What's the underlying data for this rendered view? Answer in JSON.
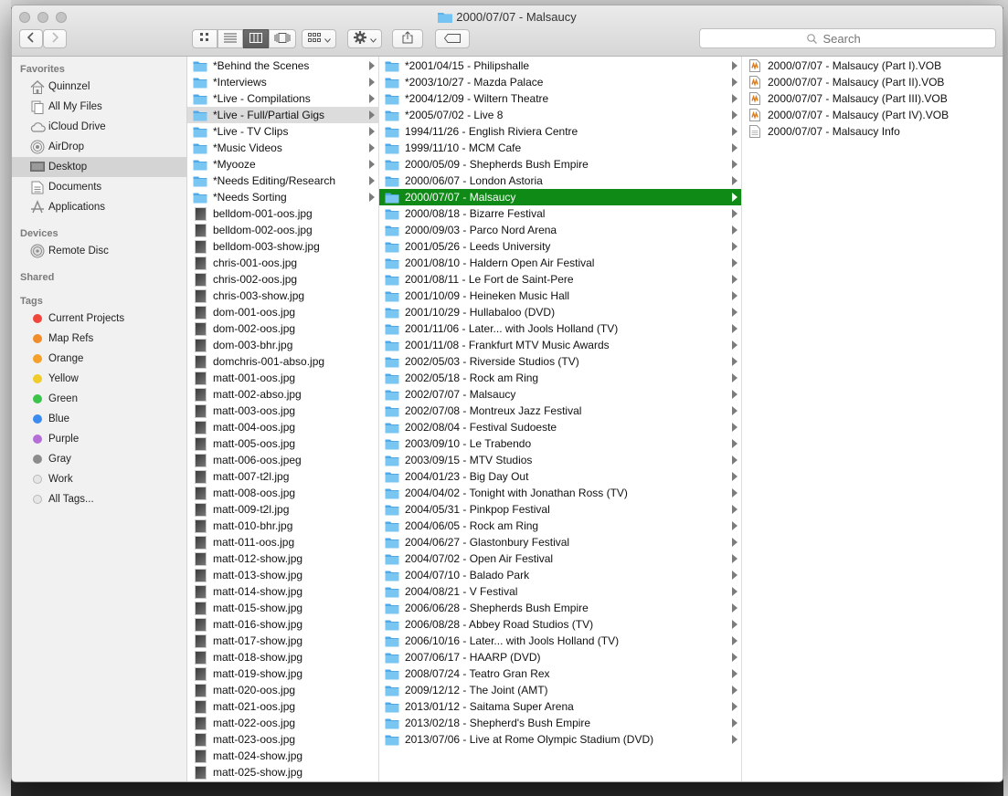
{
  "window": {
    "title": "2000/07/07 - Malsaucy"
  },
  "search": {
    "placeholder": "Search"
  },
  "sidebar": {
    "favorites_label": "Favorites",
    "favorites": [
      {
        "label": "Quinnzel",
        "icon": "home-icon"
      },
      {
        "label": "All My Files",
        "icon": "all-files-icon"
      },
      {
        "label": "iCloud Drive",
        "icon": "cloud-icon"
      },
      {
        "label": "AirDrop",
        "icon": "airdrop-icon"
      },
      {
        "label": "Desktop",
        "icon": "desktop-icon",
        "selected": true
      },
      {
        "label": "Documents",
        "icon": "documents-icon"
      },
      {
        "label": "Applications",
        "icon": "applications-icon"
      }
    ],
    "devices_label": "Devices",
    "devices": [
      {
        "label": "Remote Disc",
        "icon": "disc-icon"
      }
    ],
    "shared_label": "Shared",
    "tags_label": "Tags",
    "tags": [
      {
        "label": "Current Projects",
        "color": "#f0463c"
      },
      {
        "label": "Map Refs",
        "color": "#f08c2a"
      },
      {
        "label": "Orange",
        "color": "#f5a02a"
      },
      {
        "label": "Yellow",
        "color": "#f0cc2a"
      },
      {
        "label": "Green",
        "color": "#3cc34a"
      },
      {
        "label": "Blue",
        "color": "#3b8cf0"
      },
      {
        "label": "Purple",
        "color": "#b56ed8"
      },
      {
        "label": "Gray",
        "color": "#8c8c8c"
      },
      {
        "label": "Work",
        "color": "#e6e6e6"
      },
      {
        "label": "All Tags...",
        "color": "#e6e6e6"
      }
    ]
  },
  "column1": [
    {
      "label": "*Behind the Scenes",
      "kind": "folder"
    },
    {
      "label": "*Interviews",
      "kind": "folder"
    },
    {
      "label": "*Live - Compilations",
      "kind": "folder"
    },
    {
      "label": "*Live - Full/Partial Gigs",
      "kind": "folder",
      "selected": true
    },
    {
      "label": "*Live - TV Clips",
      "kind": "folder"
    },
    {
      "label": "*Music Videos",
      "kind": "folder"
    },
    {
      "label": "*Myooze",
      "kind": "folder"
    },
    {
      "label": "*Needs Editing/Research",
      "kind": "folder"
    },
    {
      "label": "*Needs Sorting",
      "kind": "folder"
    },
    {
      "label": "belldom-001-oos.jpg",
      "kind": "image"
    },
    {
      "label": "belldom-002-oos.jpg",
      "kind": "image"
    },
    {
      "label": "belldom-003-show.jpg",
      "kind": "image"
    },
    {
      "label": "chris-001-oos.jpg",
      "kind": "image"
    },
    {
      "label": "chris-002-oos.jpg",
      "kind": "image"
    },
    {
      "label": "chris-003-show.jpg",
      "kind": "image"
    },
    {
      "label": "dom-001-oos.jpg",
      "kind": "image"
    },
    {
      "label": "dom-002-oos.jpg",
      "kind": "image"
    },
    {
      "label": "dom-003-bhr.jpg",
      "kind": "image"
    },
    {
      "label": "domchris-001-abso.jpg",
      "kind": "image"
    },
    {
      "label": "matt-001-oos.jpg",
      "kind": "image"
    },
    {
      "label": "matt-002-abso.jpg",
      "kind": "image"
    },
    {
      "label": "matt-003-oos.jpg",
      "kind": "image"
    },
    {
      "label": "matt-004-oos.jpg",
      "kind": "image"
    },
    {
      "label": "matt-005-oos.jpg",
      "kind": "image"
    },
    {
      "label": "matt-006-oos.jpeg",
      "kind": "image"
    },
    {
      "label": "matt-007-t2l.jpg",
      "kind": "image"
    },
    {
      "label": "matt-008-oos.jpg",
      "kind": "image"
    },
    {
      "label": "matt-009-t2l.jpg",
      "kind": "image"
    },
    {
      "label": "matt-010-bhr.jpg",
      "kind": "image"
    },
    {
      "label": "matt-011-oos.jpg",
      "kind": "image"
    },
    {
      "label": "matt-012-show.jpg",
      "kind": "image"
    },
    {
      "label": "matt-013-show.jpg",
      "kind": "image"
    },
    {
      "label": "matt-014-show.jpg",
      "kind": "image"
    },
    {
      "label": "matt-015-show.jpg",
      "kind": "image"
    },
    {
      "label": "matt-016-show.jpg",
      "kind": "image"
    },
    {
      "label": "matt-017-show.jpg",
      "kind": "image"
    },
    {
      "label": "matt-018-show.jpg",
      "kind": "image"
    },
    {
      "label": "matt-019-show.jpg",
      "kind": "image"
    },
    {
      "label": "matt-020-oos.jpg",
      "kind": "image"
    },
    {
      "label": "matt-021-oos.jpg",
      "kind": "image"
    },
    {
      "label": "matt-022-oos.jpg",
      "kind": "image"
    },
    {
      "label": "matt-023-oos.jpg",
      "kind": "image"
    },
    {
      "label": "matt-024-show.jpg",
      "kind": "image"
    },
    {
      "label": "matt-025-show.jpg",
      "kind": "image"
    }
  ],
  "column2": [
    {
      "label": "*2001/04/15 - Philipshalle"
    },
    {
      "label": "*2003/10/27 - Mazda Palace"
    },
    {
      "label": "*2004/12/09 - Wiltern Theatre"
    },
    {
      "label": "*2005/07/02 - Live 8"
    },
    {
      "label": "1994/11/26 - English Riviera Centre"
    },
    {
      "label": "1999/11/10 - MCM Cafe"
    },
    {
      "label": "2000/05/09 - Shepherds Bush Empire"
    },
    {
      "label": "2000/06/07 - London Astoria"
    },
    {
      "label": "2000/07/07 - Malsaucy",
      "selected": true
    },
    {
      "label": "2000/08/18 - Bizarre Festival"
    },
    {
      "label": "2000/09/03 - Parco Nord Arena"
    },
    {
      "label": "2001/05/26 - Leeds University"
    },
    {
      "label": "2001/08/10 - Haldern Open Air Festival"
    },
    {
      "label": "2001/08/11 - Le Fort de Saint-Pere"
    },
    {
      "label": "2001/10/09 - Heineken Music Hall"
    },
    {
      "label": "2001/10/29 - Hullabaloo (DVD)"
    },
    {
      "label": "2001/11/06 - Later... with Jools Holland (TV)"
    },
    {
      "label": "2001/11/08 - Frankfurt MTV Music Awards"
    },
    {
      "label": "2002/05/03 - Riverside Studios (TV)"
    },
    {
      "label": "2002/05/18 - Rock am Ring"
    },
    {
      "label": "2002/07/07 - Malsaucy"
    },
    {
      "label": "2002/07/08 - Montreux Jazz Festival"
    },
    {
      "label": "2002/08/04 - Festival Sudoeste"
    },
    {
      "label": "2003/09/10 - Le Trabendo"
    },
    {
      "label": "2003/09/15 - MTV Studios"
    },
    {
      "label": "2004/01/23 - Big Day Out"
    },
    {
      "label": "2004/04/02 - Tonight with Jonathan Ross (TV)"
    },
    {
      "label": "2004/05/31 - Pinkpop Festival"
    },
    {
      "label": "2004/06/05 - Rock am Ring"
    },
    {
      "label": "2004/06/27 - Glastonbury Festival"
    },
    {
      "label": "2004/07/02 - Open Air Festival"
    },
    {
      "label": "2004/07/10 - Balado Park"
    },
    {
      "label": "2004/08/21 - V Festival"
    },
    {
      "label": "2006/06/28 - Shepherds Bush Empire"
    },
    {
      "label": "2006/08/28 - Abbey Road Studios (TV)"
    },
    {
      "label": "2006/10/16 - Later... with Jools Holland (TV)"
    },
    {
      "label": "2007/06/17 - HAARP (DVD)"
    },
    {
      "label": "2008/07/24 - Teatro Gran Rex"
    },
    {
      "label": "2009/12/12 - The Joint (AMT)"
    },
    {
      "label": "2013/01/12 - Saitama Super Arena"
    },
    {
      "label": "2013/02/18 - Shepherd's Bush Empire"
    },
    {
      "label": "2013/07/06 - Live at Rome Olympic Stadium (DVD)"
    }
  ],
  "column3": [
    {
      "label": "2000/07/07 - Malsaucy (Part I).VOB",
      "kind": "vob"
    },
    {
      "label": "2000/07/07 - Malsaucy (Part II).VOB",
      "kind": "vob"
    },
    {
      "label": "2000/07/07 - Malsaucy (Part III).VOB",
      "kind": "vob"
    },
    {
      "label": "2000/07/07 - Malsaucy (Part IV).VOB",
      "kind": "vob"
    },
    {
      "label": "2000/07/07 - Malsaucy Info",
      "kind": "doc"
    }
  ],
  "colors": {
    "selection_active": "#0f8a16",
    "selection_inactive": "#dcdcdc",
    "folder_blue": "#5ab4ec"
  }
}
